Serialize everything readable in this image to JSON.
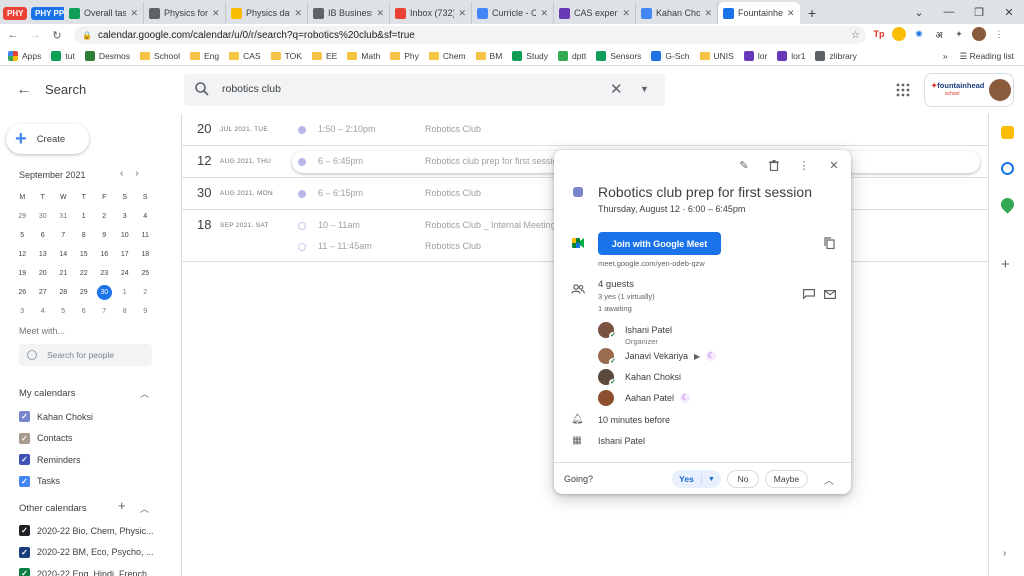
{
  "browser": {
    "tabs": [
      {
        "label": "PHY",
        "color": "#ea4335",
        "kind": "pill"
      },
      {
        "label": "PHY PP",
        "color": "#1a73e8",
        "kind": "pill"
      },
      {
        "label": "Overall task",
        "color": "#0f9d58",
        "kind": "tab",
        "icon": "sheets-icon"
      },
      {
        "label": "Physics for",
        "color": "#5f6368",
        "kind": "tab",
        "icon": "globe-icon"
      },
      {
        "label": "Physics data",
        "color": "#fbbc04",
        "kind": "tab",
        "icon": "drive-icon"
      },
      {
        "label": "IB Business",
        "color": "#5f6368",
        "kind": "tab",
        "icon": "globe-icon"
      },
      {
        "label": "Inbox (732)",
        "color": "#ea4335",
        "kind": "tab",
        "icon": "gmail-icon"
      },
      {
        "label": "Curricle - C",
        "color": "#4285f4",
        "kind": "tab",
        "icon": "curricle-icon"
      },
      {
        "label": "CAS experie",
        "color": "#673ab7",
        "kind": "tab",
        "icon": "forms-icon"
      },
      {
        "label": "Kahan Chok",
        "color": "#4285f4",
        "kind": "tab",
        "icon": "curricle-icon"
      },
      {
        "label": "Fountainhe",
        "color": "#1a73e8",
        "kind": "tab",
        "icon": "calendar-icon",
        "active": true
      }
    ],
    "new_tab_glyph": "+",
    "url": "calendar.google.com/calendar/u/0/r/search?q=robotics%20club&sf=true",
    "bookmarks": [
      {
        "label": "Apps",
        "type": "apps"
      },
      {
        "label": "tut",
        "type": "icon",
        "color": "#0f9d58"
      },
      {
        "label": "Desmos",
        "type": "icon",
        "color": "#2e7d32"
      },
      {
        "label": "School",
        "type": "folder"
      },
      {
        "label": "Eng",
        "type": "folder"
      },
      {
        "label": "CAS",
        "type": "folder"
      },
      {
        "label": "TOK",
        "type": "folder"
      },
      {
        "label": "EE",
        "type": "folder"
      },
      {
        "label": "Math",
        "type": "folder"
      },
      {
        "label": "Phy",
        "type": "folder"
      },
      {
        "label": "Chem",
        "type": "folder"
      },
      {
        "label": "BM",
        "type": "folder"
      },
      {
        "label": "Study",
        "type": "icon",
        "color": "#0f9d58"
      },
      {
        "label": "dptt",
        "type": "icon",
        "color": "#34a853"
      },
      {
        "label": "Sensors",
        "type": "icon",
        "color": "#0f9d58"
      },
      {
        "label": "G-Sch",
        "type": "icon",
        "color": "#1a73e8"
      },
      {
        "label": "UNIS",
        "type": "folder"
      },
      {
        "label": "lor",
        "type": "icon",
        "color": "#673ab7"
      },
      {
        "label": "lor1",
        "type": "icon",
        "color": "#673ab7"
      },
      {
        "label": "zlibrary",
        "type": "icon",
        "color": "#5f6368"
      }
    ],
    "reading_list": "Reading list",
    "more_bookmarks": "»"
  },
  "header": {
    "title": "Search",
    "query": "robotics club",
    "brand_name": "fountainhead",
    "brand_sub": "school"
  },
  "sidebar": {
    "create_label": "Create",
    "month_label": "September 2021",
    "weekdays": [
      "M",
      "T",
      "W",
      "T",
      "F",
      "S",
      "S"
    ],
    "weeks": [
      [
        {
          "d": "29",
          "dim": true
        },
        {
          "d": "30",
          "dim": true
        },
        {
          "d": "31",
          "dim": true
        },
        {
          "d": "1"
        },
        {
          "d": "2"
        },
        {
          "d": "3"
        },
        {
          "d": "4"
        }
      ],
      [
        {
          "d": "5"
        },
        {
          "d": "6"
        },
        {
          "d": "7"
        },
        {
          "d": "8"
        },
        {
          "d": "9"
        },
        {
          "d": "10"
        },
        {
          "d": "11"
        }
      ],
      [
        {
          "d": "12"
        },
        {
          "d": "13"
        },
        {
          "d": "14"
        },
        {
          "d": "15"
        },
        {
          "d": "16"
        },
        {
          "d": "17"
        },
        {
          "d": "18"
        }
      ],
      [
        {
          "d": "19"
        },
        {
          "d": "20"
        },
        {
          "d": "21"
        },
        {
          "d": "22"
        },
        {
          "d": "23"
        },
        {
          "d": "24"
        },
        {
          "d": "25"
        }
      ],
      [
        {
          "d": "26"
        },
        {
          "d": "27"
        },
        {
          "d": "28"
        },
        {
          "d": "29"
        },
        {
          "d": "30",
          "today": true
        },
        {
          "d": "1",
          "dim": true
        },
        {
          "d": "2",
          "dim": true
        }
      ],
      [
        {
          "d": "3",
          "dim": true
        },
        {
          "d": "4",
          "dim": true
        },
        {
          "d": "5",
          "dim": true
        },
        {
          "d": "6",
          "dim": true
        },
        {
          "d": "7",
          "dim": true
        },
        {
          "d": "8",
          "dim": true
        },
        {
          "d": "9",
          "dim": true
        }
      ]
    ],
    "meet_with_label": "Meet with...",
    "people_placeholder": "Search for people",
    "my_calendars_label": "My calendars",
    "my_calendars": [
      {
        "name": "Kahan Choksi",
        "color": "#7986cb"
      },
      {
        "name": "Contacts",
        "color": "#a79b8e"
      },
      {
        "name": "Reminders",
        "color": "#3f51b5"
      },
      {
        "name": "Tasks",
        "color": "#4285f4"
      }
    ],
    "other_calendars_label": "Other calendars",
    "other_calendars": [
      {
        "name": "2020-22 Bio, Chem, Physic...",
        "color": "#202124"
      },
      {
        "name": "2020-22 BM, Eco, Psycho, ...",
        "color": "#1a3d7c"
      },
      {
        "name": "2020-22 Eng, Hindi, French...",
        "color": "#0b8043"
      }
    ]
  },
  "results": [
    {
      "day": "20",
      "date": "JUL 2021, TUE",
      "rows": [
        {
          "time": "1:50 – 2:10pm",
          "title": "Robotics Club",
          "hollow": false
        }
      ]
    },
    {
      "day": "12",
      "date": "AUG 2021, THU",
      "rows": [
        {
          "time": "6 – 6:45pm",
          "title": "Robotics club prep for first session",
          "hollow": false,
          "selected": true
        }
      ]
    },
    {
      "day": "30",
      "date": "AUG 2021, MON",
      "rows": [
        {
          "time": "6 – 6:15pm",
          "title": "Robotics Club",
          "hollow": false
        }
      ]
    },
    {
      "day": "18",
      "date": "SEP 2021, SAT",
      "rows": [
        {
          "time": "10 – 11am",
          "title": "Robotics Club _ Internal Meeting",
          "hollow": true
        },
        {
          "time": "11 – 11:45am",
          "title": "Robotics Club",
          "hollow": true
        }
      ]
    }
  ],
  "event": {
    "title": "Robotics club prep for first session",
    "when": "Thursday, August 12  ·  6:00 – 6:45pm",
    "color": "#7986cb",
    "meet_button": "Join with Google Meet",
    "meet_link": "meet.google.com/yen-odeb-qzw",
    "guests_title": "4 guests",
    "guests_yes": "3 yes (1 virtually)",
    "guests_awaiting": "1 awaiting",
    "guests": [
      {
        "name": "Ishani Patel",
        "role": "Organizer",
        "check": true,
        "moon": false,
        "video": false,
        "color": "#7a5240"
      },
      {
        "name": "Janavi Vekariya",
        "role": "",
        "check": true,
        "moon": true,
        "video": true,
        "color": "#9a6b4e"
      },
      {
        "name": "Kahan Choksi",
        "role": "",
        "check": true,
        "moon": false,
        "video": false,
        "color": "#5d4a3e"
      },
      {
        "name": "Aahan Patel",
        "role": "",
        "check": false,
        "moon": true,
        "video": false,
        "color": "#8a5030"
      }
    ],
    "reminder": "10 minutes before",
    "organizer_calendar": "Ishani Patel",
    "going_label": "Going?",
    "rsvp_yes": "Yes",
    "rsvp_no": "No",
    "rsvp_maybe": "Maybe"
  }
}
